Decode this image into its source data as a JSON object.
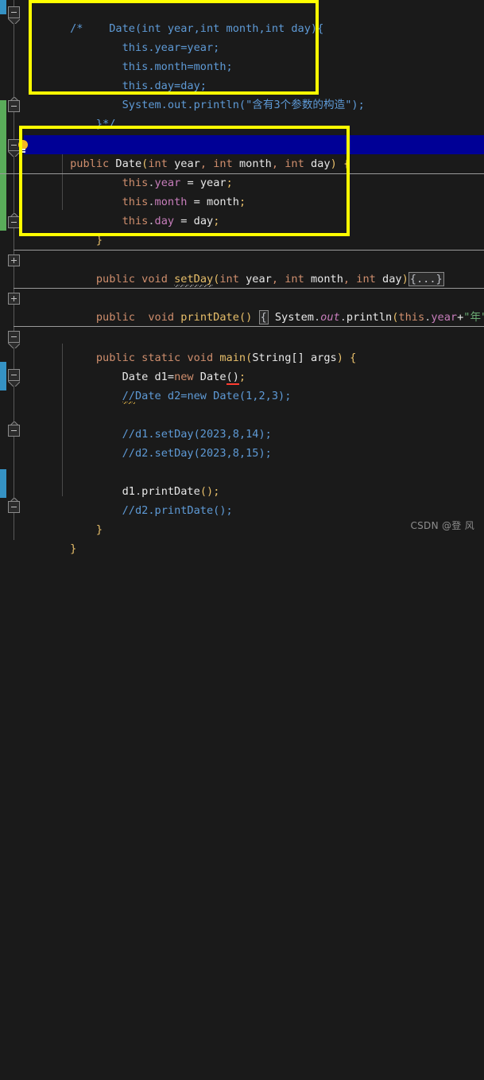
{
  "app": {
    "kind": "java-code-editor",
    "theme": "dark",
    "background": "#1a1a1a",
    "selection_color": "#000096",
    "annotation_color": "#ffff00"
  },
  "gutter": {
    "change_bars": [
      {
        "color": "#3592c4",
        "label": "modified-line-marker-top"
      },
      {
        "color": "#5aac5a",
        "label": "added-line-marker"
      },
      {
        "color": "#3592c4",
        "label": "modified-line-marker-main"
      },
      {
        "color": "#3592c4",
        "label": "modified-line-marker-print"
      }
    ],
    "fold_markers": [
      {
        "state": "expanded",
        "label": "fold-comment-block"
      },
      {
        "state": "expanded",
        "label": "fold-constructor"
      },
      {
        "state": "collapsed",
        "label": "fold-setday"
      },
      {
        "state": "collapsed",
        "label": "fold-printdate"
      },
      {
        "state": "expanded",
        "label": "fold-main"
      },
      {
        "state": "expanded",
        "label": "fold-main-end"
      }
    ],
    "intention_bulb": "lightbulb-icon"
  },
  "code": {
    "lines": [
      {
        "id": "l1",
        "text": "/*    Date(int year,int month,int day){"
      },
      {
        "id": "l2",
        "text": "        this.year=year;"
      },
      {
        "id": "l3",
        "text": "        this.month=month;"
      },
      {
        "id": "l4",
        "text": "        this.day=day;"
      },
      {
        "id": "l5",
        "text": "        System.out.println(\"含有3个参数的构造\");"
      },
      {
        "id": "l6",
        "text": "    }*/"
      },
      {
        "id": "l7",
        "text": "    public Date(int year, int month, int day) {"
      },
      {
        "id": "l8",
        "text": "        this.year = year;"
      },
      {
        "id": "l9",
        "text": "        this.month = month;"
      },
      {
        "id": "l10",
        "text": "        this.day = day;"
      },
      {
        "id": "l11",
        "text": "    }"
      },
      {
        "id": "l12",
        "text": "    public void setDay(int year, int month, int day){...}"
      },
      {
        "id": "l13",
        "text": "    public  void printDate() { System.out.println(this.year+\"年\"+this.month"
      },
      {
        "id": "l14",
        "text": "    public static void main(String[] args) {"
      },
      {
        "id": "l15",
        "text": "        Date d1=new Date();"
      },
      {
        "id": "l16",
        "text": "        //Date d2=new Date(1,2,3);"
      },
      {
        "id": "l17",
        "text": "        //d1.setDay(2023,8,14);"
      },
      {
        "id": "l18",
        "text": "        //d2.setDay(2023,8,15);"
      },
      {
        "id": "l19",
        "text": "        d1.printDate();"
      },
      {
        "id": "l20",
        "text": "        //d2.printDate();"
      },
      {
        "id": "l21",
        "text": "    }"
      },
      {
        "id": "l22",
        "text": "}"
      }
    ],
    "tokens": {
      "comment_open": "/*",
      "comment_close": "}*/",
      "kw_public": "public",
      "kw_static": "static",
      "kw_void": "void",
      "kw_new": "new",
      "kw_int": "int",
      "type_String": "String[]",
      "class_Date": "Date",
      "this": "this",
      "field_year": "year",
      "field_month": "month",
      "field_day": "day",
      "method_setDay": "setDay",
      "method_printDate": "printDate",
      "method_main": "main",
      "method_println": "println",
      "obj_System": "System",
      "obj_out": "out",
      "var_d1": "d1",
      "var_d2": "d2",
      "string_zh_year": "\"年\"",
      "string_zh_ctor": "\"含有3个参数的构造\"",
      "fold_placeholder": "{...}",
      "fold_placeholder_brace": "{",
      "num_2023": "2023",
      "num_8": "8",
      "num_14": "14",
      "num_15": "15",
      "num_1": "1",
      "num_2": "2",
      "num_3": "3"
    }
  },
  "annotations": {
    "box_commented_constructor": "highlight-box-commented-constructor",
    "box_active_constructor": "highlight-box-active-constructor"
  },
  "watermark": {
    "text": "CSDN @登 风"
  }
}
